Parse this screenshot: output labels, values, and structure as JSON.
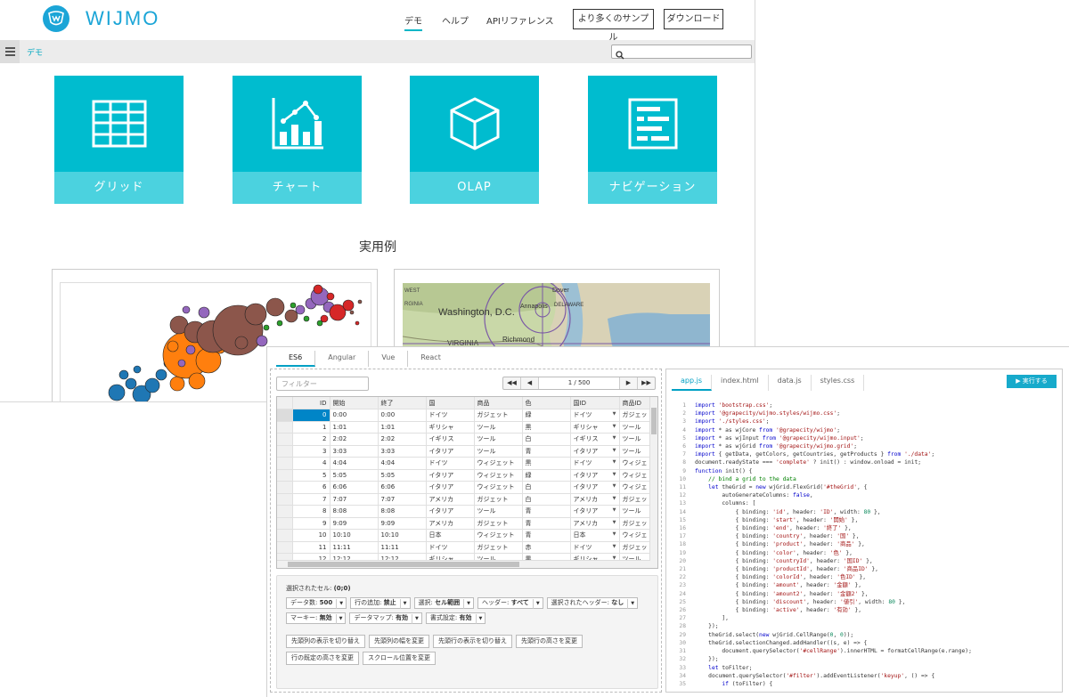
{
  "site": {
    "brand": "WIJMO",
    "nav": [
      "デモ",
      "ヘルプ",
      "APIリファレンス"
    ],
    "buttons": [
      "より多くのサンプル",
      "ダウンロード"
    ],
    "breadcrumb": "デモ",
    "search_placeholder": "",
    "tiles": [
      "グリッド",
      "チャート",
      "OLAP",
      "ナビゲーション"
    ],
    "examples_title": "実用例",
    "map_labels": [
      "Washington, D.C.",
      "VIRGINIA",
      "Richmond",
      "Dover",
      "Annapolis",
      "DELAWARE",
      "WEST",
      "RGINIA"
    ]
  },
  "demo": {
    "framework_tabs": [
      "ES6",
      "Angular",
      "Vue",
      "React"
    ],
    "filter_placeholder": "フィルター",
    "pager": {
      "first": "◀◀",
      "prev": "◀",
      "status": "1 / 500",
      "next": "▶",
      "last": "▶▶"
    },
    "grid": {
      "headers": [
        "ID",
        "開始",
        "終了",
        "国",
        "商品",
        "色",
        "国ID",
        "商品ID"
      ],
      "rows": [
        [
          "0",
          "0:00",
          "0:00",
          "ドイツ",
          "ガジェット",
          "緑",
          "ドイツ",
          "ガジェッ"
        ],
        [
          "1",
          "1:01",
          "1:01",
          "ギリシャ",
          "ツール",
          "黒",
          "ギリシャ",
          "ツール"
        ],
        [
          "2",
          "2:02",
          "2:02",
          "イギリス",
          "ツール",
          "白",
          "イギリス",
          "ツール"
        ],
        [
          "3",
          "3:03",
          "3:03",
          "イタリア",
          "ツール",
          "青",
          "イタリア",
          "ツール"
        ],
        [
          "4",
          "4:04",
          "4:04",
          "ドイツ",
          "ウィジェット",
          "黒",
          "ドイツ",
          "ウィジェ"
        ],
        [
          "5",
          "5:05",
          "5:05",
          "イタリア",
          "ウィジェット",
          "緑",
          "イタリア",
          "ウィジェ"
        ],
        [
          "6",
          "6:06",
          "6:06",
          "イタリア",
          "ウィジェット",
          "白",
          "イタリア",
          "ウィジェ"
        ],
        [
          "7",
          "7:07",
          "7:07",
          "アメリカ",
          "ガジェット",
          "白",
          "アメリカ",
          "ガジェッ"
        ],
        [
          "8",
          "8:08",
          "8:08",
          "イタリア",
          "ツール",
          "青",
          "イタリア",
          "ツール"
        ],
        [
          "9",
          "9:09",
          "9:09",
          "アメリカ",
          "ガジェット",
          "青",
          "アメリカ",
          "ガジェッ"
        ],
        [
          "10",
          "10:10",
          "10:10",
          "日本",
          "ウィジェット",
          "青",
          "日本",
          "ウィジェ"
        ],
        [
          "11",
          "11:11",
          "11:11",
          "ドイツ",
          "ガジェット",
          "赤",
          "ドイツ",
          "ガジェッ"
        ],
        [
          "12",
          "12:12",
          "12:12",
          "ギリシャ",
          "ツール",
          "黒",
          "ギリシャ",
          "ツール"
        ]
      ]
    },
    "selected_cell_label": "選択されたセル:",
    "selected_cell_value": "(0;0)",
    "options_row1": [
      {
        "label": "データ数:",
        "value": "500"
      },
      {
        "label": "行の追加:",
        "value": "禁止"
      },
      {
        "label": "選択:",
        "value": "セル範囲"
      },
      {
        "label": "ヘッダー:",
        "value": "すべて"
      },
      {
        "label": "選択されたヘッダー:",
        "value": "なし"
      }
    ],
    "options_row2": [
      {
        "label": "マーキー:",
        "value": "無効"
      },
      {
        "label": "データマップ:",
        "value": "有効"
      },
      {
        "label": "書式設定:",
        "value": "有効"
      }
    ],
    "actions_row1": [
      "先頭列の表示を切り替え",
      "先頭列の幅を変更",
      "先頭行の表示を切り替え",
      "先頭行の高さを変更"
    ],
    "actions_row2": [
      "行の既定の高さを変更",
      "スクロール位置を変更"
    ],
    "file_tabs": [
      "app.js",
      "index.html",
      "data.js",
      "styles.css"
    ],
    "run_button": "▶ 実行する",
    "code_lines": [
      "import 'bootstrap.css';",
      "import '@grapecity/wijmo.styles/wijmo.css';",
      "import './styles.css';",
      "import * as wjCore from '@grapecity/wijmo';",
      "import * as wjInput from '@grapecity/wijmo.input';",
      "import * as wjGrid from '@grapecity/wijmo.grid';",
      "import { getData, getColors, getCountries, getProducts } from './data';",
      "document.readyState === 'complete' ? init() : window.onload = init;",
      "function init() {",
      "    // bind a grid to the data",
      "    let theGrid = new wjGrid.FlexGrid('#theGrid', {",
      "        autoGenerateColumns: false,",
      "        columns: [",
      "            { binding: 'id', header: 'ID', width: 80 },",
      "            { binding: 'start', header: '開始' },",
      "            { binding: 'end', header: '終了' },",
      "            { binding: 'country', header: '国' },",
      "            { binding: 'product', header: '商品' },",
      "            { binding: 'color', header: '色' },",
      "            { binding: 'countryId', header: '国ID' },",
      "            { binding: 'productId', header: '商品ID' },",
      "            { binding: 'colorId', header: '色ID' },",
      "            { binding: 'amount', header: '金額' },",
      "            { binding: 'amount2', header: '金額2' },",
      "            { binding: 'discount', header: '値引', width: 80 },",
      "            { binding: 'active', header: '有効' },",
      "        ],",
      "    });",
      "    theGrid.select(new wjGrid.CellRange(0, 0));",
      "    theGrid.selectionChanged.addHandler((s, e) => {",
      "        document.querySelector('#cellRange').innerHTML = formatCellRange(e.range);",
      "    });",
      "    let toFilter;",
      "    document.querySelector('#filter').addEventListener('keyup', () => {",
      "        if (toFilter) {"
    ]
  }
}
